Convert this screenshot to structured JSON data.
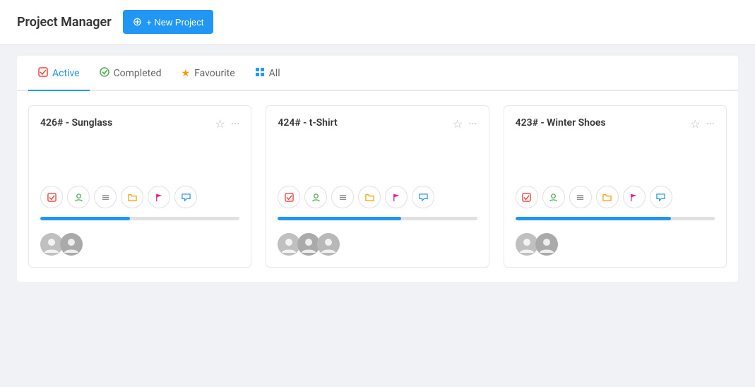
{
  "header": {
    "title": "Project Manager",
    "new_project_label": "+ New Project"
  },
  "tabs": [
    {
      "id": "active",
      "label": "Active",
      "icon": "active-icon",
      "active": true
    },
    {
      "id": "completed",
      "label": "Completed",
      "icon": "completed-icon",
      "active": false
    },
    {
      "id": "favourite",
      "label": "Favourite",
      "icon": "favourite-icon",
      "active": false
    },
    {
      "id": "all",
      "label": "All",
      "icon": "all-icon",
      "active": false
    }
  ],
  "projects": [
    {
      "id": "426",
      "title": "426# - Sunglass",
      "progress": 45,
      "avatars": 2
    },
    {
      "id": "424",
      "title": "424# - t-Shirt",
      "progress": 62,
      "avatars": 3
    },
    {
      "id": "423",
      "title": "423# - Winter Shoes",
      "progress": 78,
      "avatars": 2
    }
  ],
  "icons": {
    "task": "✓",
    "user": "👤",
    "list": "☰",
    "folder": "📁",
    "flag": "⚑",
    "chat": "💬",
    "plus": "+",
    "star_empty": "☆",
    "menu_dots": "⋯"
  },
  "colors": {
    "active_tab": "#2196f3",
    "progress_bar": "#2196f3",
    "completed_icon": "#4caf50",
    "favourite_icon": "#ff9800",
    "all_icon": "#2196f3"
  }
}
